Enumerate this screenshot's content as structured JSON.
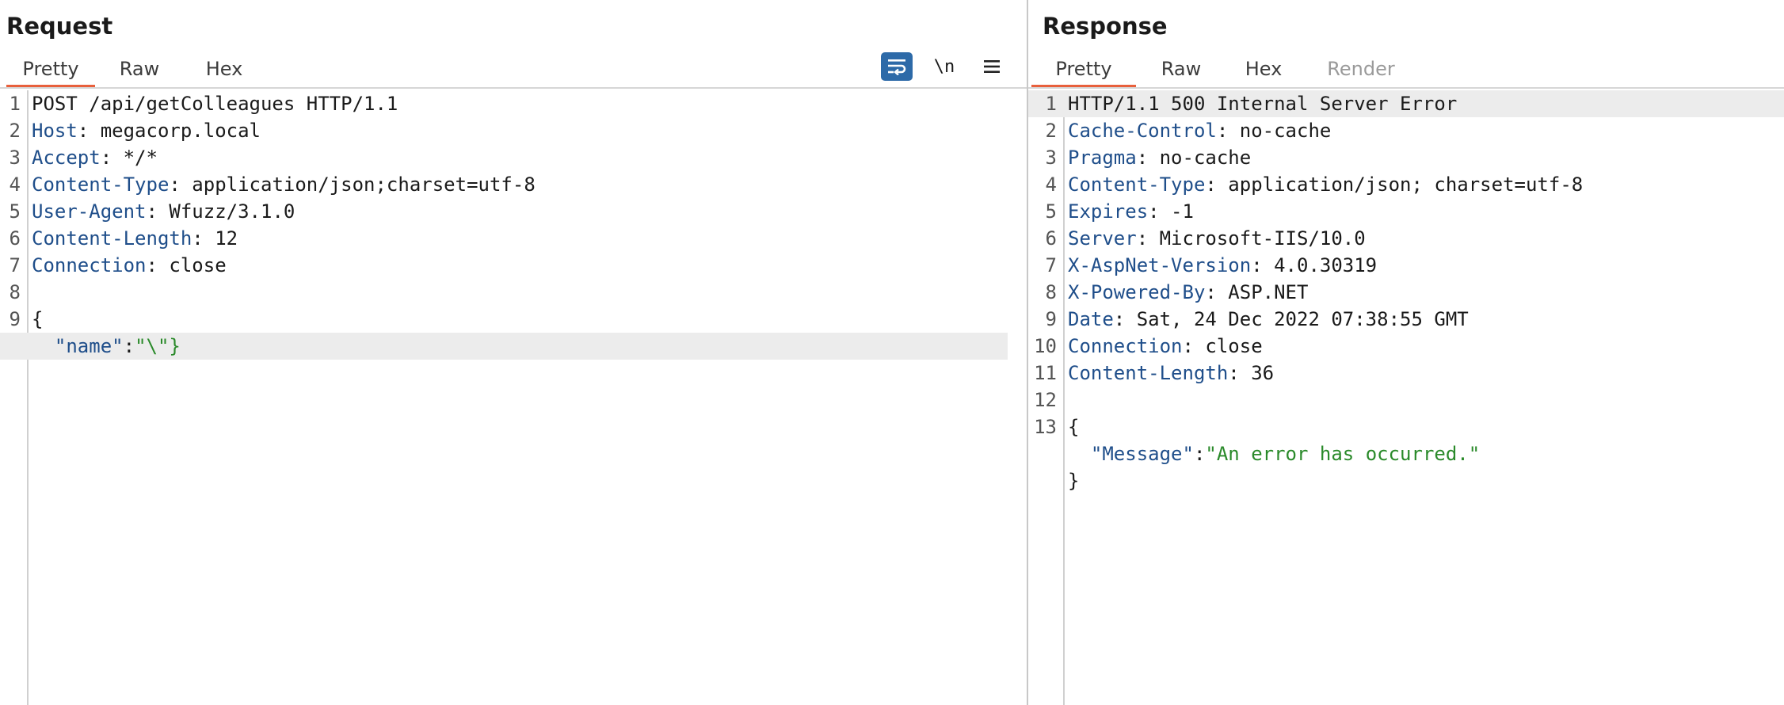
{
  "request": {
    "title": "Request",
    "tabs": [
      "Pretty",
      "Raw",
      "Hex"
    ],
    "active_tab": "Pretty",
    "tools": {
      "newline_label": "\\n"
    },
    "lines": [
      {
        "n": "1",
        "text": "POST /api/getColleagues HTTP/1.1"
      },
      {
        "n": "2",
        "key": "Host",
        "value": " megacorp.local"
      },
      {
        "n": "3",
        "key": "Accept",
        "value": " */*"
      },
      {
        "n": "4",
        "key": "Content-Type",
        "value": " application/json;charset=utf-8"
      },
      {
        "n": "5",
        "key": "User-Agent",
        "value": " Wfuzz/3.1.0"
      },
      {
        "n": "6",
        "key": "Content-Length",
        "value": " 12"
      },
      {
        "n": "7",
        "key": "Connection",
        "value": " close"
      },
      {
        "n": "8",
        "text": ""
      },
      {
        "n": "9",
        "text": "{"
      },
      {
        "n": "",
        "indent": "  ",
        "jkey": "\"name\"",
        "sep": ":",
        "jval": "\"\\\"}"
      }
    ]
  },
  "response": {
    "title": "Response",
    "tabs": [
      "Pretty",
      "Raw",
      "Hex",
      "Render"
    ],
    "active_tab": "Pretty",
    "lines": [
      {
        "n": "1",
        "text": "HTTP/1.1 500 Internal Server Error"
      },
      {
        "n": "2",
        "key": "Cache-Control",
        "value": " no-cache"
      },
      {
        "n": "3",
        "key": "Pragma",
        "value": " no-cache"
      },
      {
        "n": "4",
        "key": "Content-Type",
        "value": " application/json; charset=utf-8"
      },
      {
        "n": "5",
        "key": "Expires",
        "value": " -1"
      },
      {
        "n": "6",
        "key": "Server",
        "value": " Microsoft-IIS/10.0"
      },
      {
        "n": "7",
        "key": "X-AspNet-Version",
        "value": " 4.0.30319"
      },
      {
        "n": "8",
        "key": "X-Powered-By",
        "value": " ASP.NET"
      },
      {
        "n": "9",
        "key": "Date",
        "value": " Sat, 24 Dec 2022 07:38:55 GMT"
      },
      {
        "n": "10",
        "key": "Connection",
        "value": " close"
      },
      {
        "n": "11",
        "key": "Content-Length",
        "value": " 36"
      },
      {
        "n": "12",
        "text": ""
      },
      {
        "n": "13",
        "text": "{"
      },
      {
        "n": "",
        "indent": "  ",
        "jkey": "\"Message\"",
        "sep": ":",
        "jval": "\"An error has occurred.\""
      },
      {
        "n": "",
        "text": "}"
      }
    ]
  },
  "colors": {
    "accent": "#e8603c",
    "header_key": "#1f4e8a",
    "json_string": "#2a8a2a",
    "wrap_button": "#2d6aa8"
  }
}
